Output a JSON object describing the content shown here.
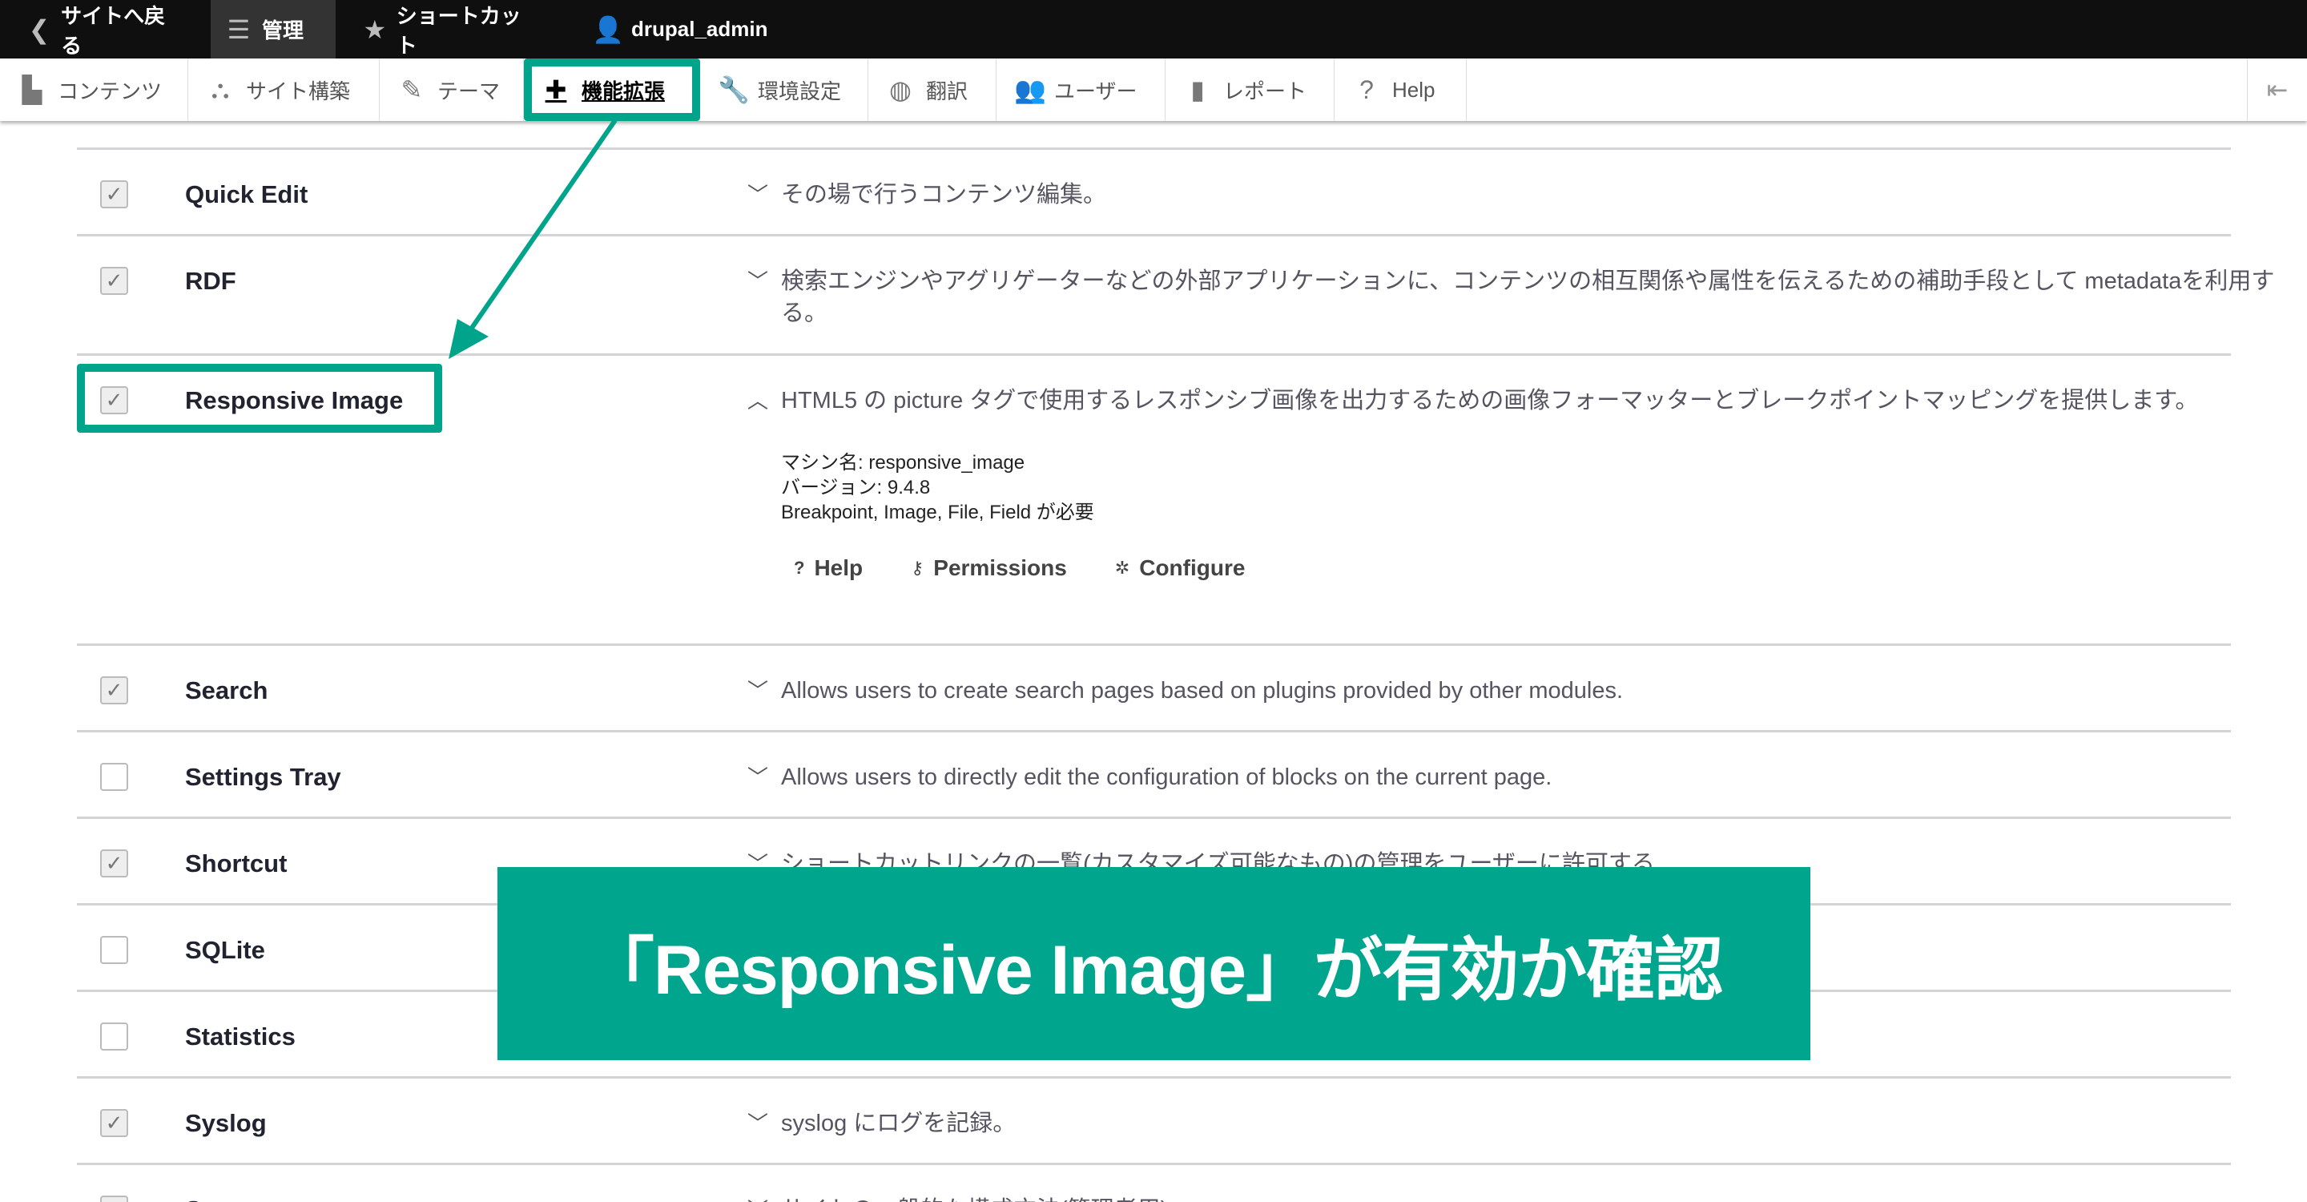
{
  "topbar": {
    "items": [
      {
        "label": "サイトへ戻る",
        "icon": "back-icon"
      },
      {
        "label": "管理",
        "icon": "menu-icon",
        "active": true
      },
      {
        "label": "ショートカット",
        "icon": "star-icon"
      },
      {
        "label": "drupal_admin",
        "icon": "user-icon"
      }
    ]
  },
  "tray": {
    "items": [
      {
        "label": "コンテンツ",
        "icon": "file-icon"
      },
      {
        "label": "サイト構築",
        "icon": "structure-icon"
      },
      {
        "label": "テーマ",
        "icon": "brush-icon"
      },
      {
        "label": "機能拡張",
        "icon": "puzzle-icon",
        "active": true
      },
      {
        "label": "環境設定",
        "icon": "wrench-icon"
      },
      {
        "label": "翻訳",
        "icon": "globe-icon"
      },
      {
        "label": "ユーザー",
        "icon": "people-icon"
      },
      {
        "label": "レポート",
        "icon": "chart-icon"
      },
      {
        "label": "Help",
        "icon": "help-icon"
      }
    ],
    "toggle_icon": "collapse-icon"
  },
  "modules": [
    {
      "name": "Quick Edit",
      "checked": true,
      "description": "その場で行うコンテンツ編集。"
    },
    {
      "name": "RDF",
      "checked": true,
      "description": "検索エンジンやアグリゲーターなどの外部アプリケーションに、コンテンツの相互関係や属性を伝えるための補助手段として metadataを利用する。"
    },
    {
      "name": "Responsive Image",
      "checked": true,
      "expanded": true,
      "description": "HTML5 の picture タグで使用するレスポンシブ画像を出力するための画像フォーマッターとブレークポイントマッピングを提供します。",
      "machine_name": "マシン名: responsive_image",
      "version": "バージョン: 9.4.8",
      "requires": "Breakpoint, Image, File, Field が必要",
      "links": [
        {
          "label": "Help",
          "icon": "help-icon"
        },
        {
          "label": "Permissions",
          "icon": "key-icon"
        },
        {
          "label": "Configure",
          "icon": "gear-icon"
        }
      ]
    },
    {
      "name": "Search",
      "checked": true,
      "description": "Allows users to create search pages based on plugins provided by other modules."
    },
    {
      "name": "Settings Tray",
      "checked": false,
      "description": "Allows users to directly edit the configuration of blocks on the current page."
    },
    {
      "name": "Shortcut",
      "checked": true,
      "description": "ショートカットリンクの一覧(カスタマイズ可能なもの)の管理をユーザーに許可する"
    },
    {
      "name": "SQLite",
      "checked": false,
      "description": ""
    },
    {
      "name": "Statistics",
      "checked": false,
      "description": ""
    },
    {
      "name": "Syslog",
      "checked": true,
      "description": "syslog にログを記録。"
    },
    {
      "name": "System",
      "checked": true,
      "description": "サイトの一般的な構成方法(管理者用)"
    }
  ],
  "annotation": {
    "text": "「Responsive Image」が有効か確認",
    "color": "#00a58e"
  }
}
